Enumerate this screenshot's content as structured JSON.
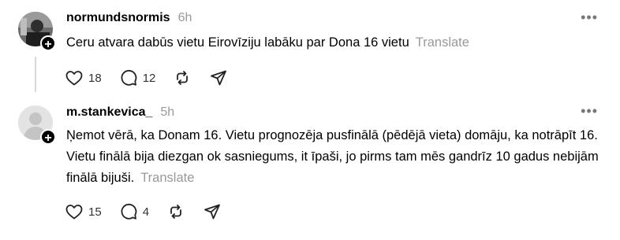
{
  "posts": [
    {
      "username": "normundsnormis",
      "time": "6h",
      "text": "Ceru atvara dabūs vietu Eirovīziju labāku par Dona 16 vietu",
      "translate": "Translate",
      "likes": "18",
      "replies": "12",
      "avatar": "photo-avatar",
      "more_icon": "•••"
    },
    {
      "username": "m.stankevica_",
      "time": "5h",
      "text": "Ņemot vērā, ka Donam 16. Vietu prognozēja pusfinālā (pēdējā vieta) domāju, ka notrāpīt 16. Vietu finālā bija diezgan ok sasniegums, it īpaši, jo pirms tam mēs gandrīz 10 gadus nebijām finālā bijuši.",
      "translate": "Translate",
      "likes": "15",
      "replies": "4",
      "avatar": "default-avatar",
      "more_icon": "•••"
    }
  ],
  "icons": {
    "like": "heart-icon",
    "reply": "comment-icon",
    "repost": "repost-icon",
    "share": "send-icon",
    "follow": "plus-icon"
  },
  "colors": {
    "muted": "#999999",
    "text": "#000000",
    "divider": "#d9d9d9"
  }
}
